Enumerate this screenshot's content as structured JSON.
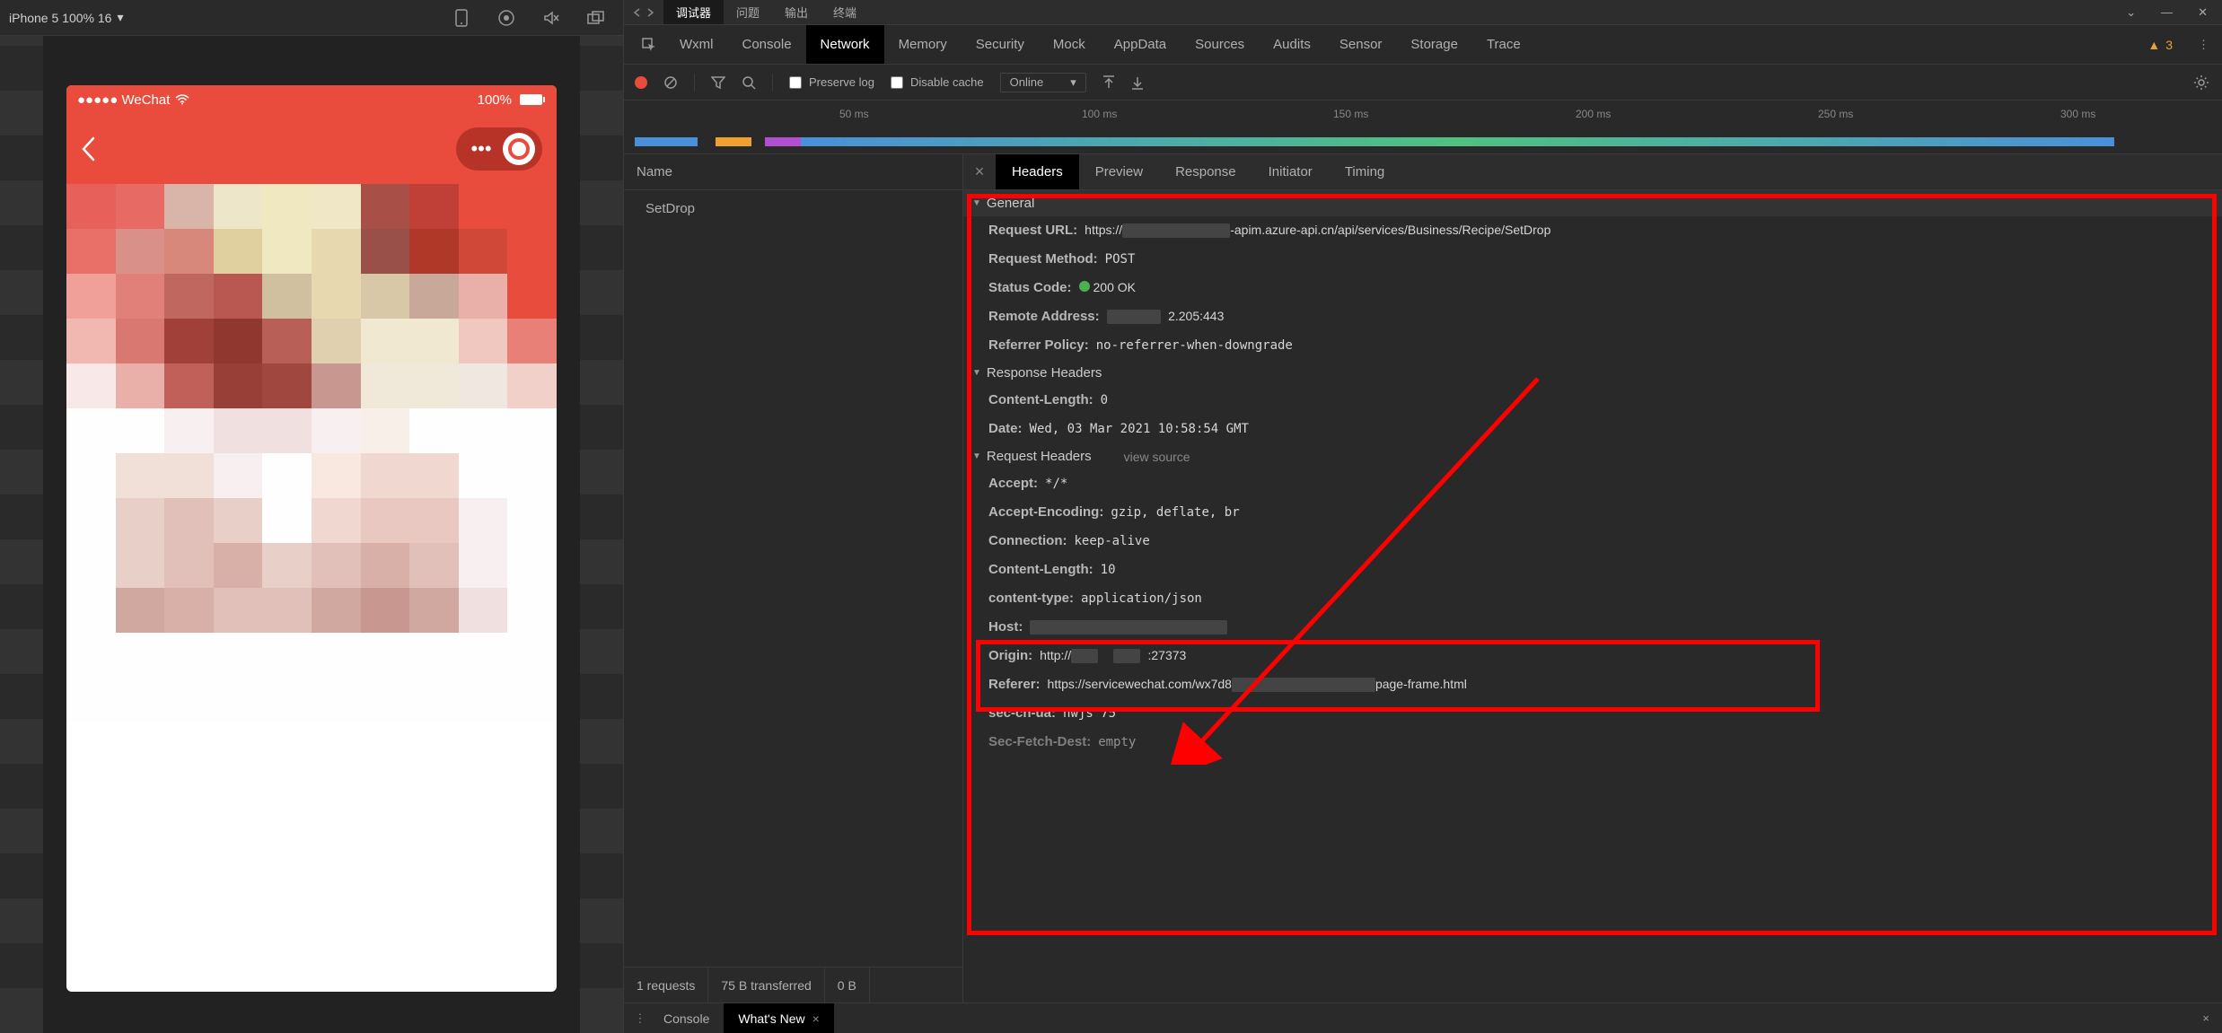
{
  "sim": {
    "device": "iPhone 5 100% 16",
    "statusbar": {
      "carrier": "●●●●● WeChat",
      "battery": "100%"
    }
  },
  "top_tabs": {
    "debugger": "调试器",
    "problems": "问题",
    "output": "输出",
    "terminal": "终端"
  },
  "main_tabs": {
    "wxml": "Wxml",
    "console": "Console",
    "network": "Network",
    "memory": "Memory",
    "security": "Security",
    "mock": "Mock",
    "appdata": "AppData",
    "sources": "Sources",
    "audits": "Audits",
    "sensor": "Sensor",
    "storage": "Storage",
    "trace": "Trace"
  },
  "warn_count": "3",
  "filter": {
    "preserve": "Preserve log",
    "disable_cache": "Disable cache",
    "throttle": "Online"
  },
  "timeline_ticks": [
    "50 ms",
    "100 ms",
    "150 ms",
    "200 ms",
    "250 ms",
    "300 ms"
  ],
  "request_list": {
    "header": "Name",
    "items": [
      "SetDrop"
    ]
  },
  "detail_tabs": {
    "headers": "Headers",
    "preview": "Preview",
    "response": "Response",
    "initiator": "Initiator",
    "timing": "Timing"
  },
  "headers": {
    "general_title": "General",
    "general": {
      "request_url_k": "Request URL:",
      "request_url_v1": "https://",
      "request_url_v2": "-apim.azure-api.cn/api/services/Business/Recipe/SetDrop",
      "method_k": "Request Method:",
      "method_v": "POST",
      "status_k": "Status Code:",
      "status_v": "200 OK",
      "remote_k": "Remote Address:",
      "remote_v": "2.205:443",
      "refpolicy_k": "Referrer Policy:",
      "refpolicy_v": "no-referrer-when-downgrade"
    },
    "response_title": "Response Headers",
    "response": {
      "cl_k": "Content-Length:",
      "cl_v": "0",
      "date_k": "Date:",
      "date_v": "Wed, 03 Mar 2021 10:58:54 GMT"
    },
    "request_title": "Request Headers",
    "view_source": "view source",
    "request": {
      "accept_k": "Accept:",
      "accept_v": "*/*",
      "ae_k": "Accept-Encoding:",
      "ae_v": "gzip, deflate, br",
      "conn_k": "Connection:",
      "conn_v": "keep-alive",
      "cl_k": "Content-Length:",
      "cl_v": "10",
      "ct_k": "content-type:",
      "ct_v": "application/json",
      "host_k": "Host:",
      "origin_k": "Origin:",
      "origin_v1": "http://",
      "origin_v2": ":27373",
      "referer_k": "Referer:",
      "referer_v1": "https://servicewechat.com/wx7d8",
      "referer_v2": "page-frame.html",
      "schua_k": "sec-ch-ua:",
      "schua_v": "nwjs 75",
      "sfd_k": "Sec-Fetch-Dest:",
      "sfd_v": "empty"
    }
  },
  "status_bar": {
    "requests": "1 requests",
    "transferred": "75 B transferred",
    "resources": "0 B"
  },
  "drawer": {
    "console": "Console",
    "whatsnew": "What's New"
  }
}
